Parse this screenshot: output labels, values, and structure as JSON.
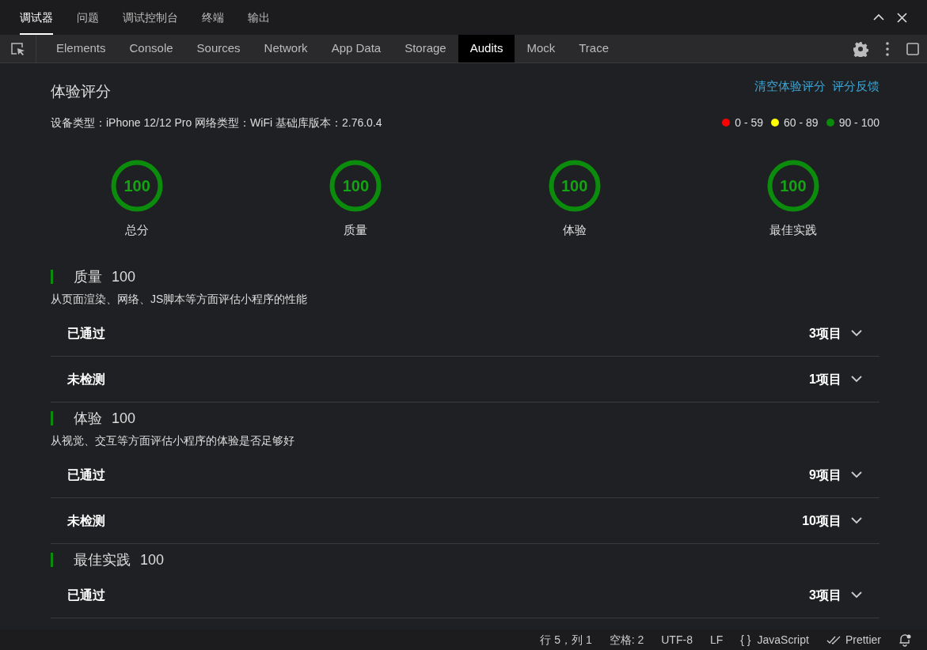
{
  "panel_tabs": [
    {
      "label": "调试器",
      "selected": true
    },
    {
      "label": "问题",
      "selected": false
    },
    {
      "label": "调试控制台",
      "selected": false
    },
    {
      "label": "终端",
      "selected": false
    },
    {
      "label": "输出",
      "selected": false
    }
  ],
  "devtools_tabs": [
    {
      "label": "Elements",
      "selected": false
    },
    {
      "label": "Console",
      "selected": false
    },
    {
      "label": "Sources",
      "selected": false
    },
    {
      "label": "Network",
      "selected": false
    },
    {
      "label": "App Data",
      "selected": false
    },
    {
      "label": "Storage",
      "selected": false
    },
    {
      "label": "Audits",
      "selected": true
    },
    {
      "label": "Mock",
      "selected": false
    },
    {
      "label": "Trace",
      "selected": false
    }
  ],
  "audit": {
    "title": "体验评分",
    "links": [
      "清空体验评分",
      "评分反馈"
    ],
    "device_info": "设备类型：iPhone 12/12 Pro 网络类型：WiFi 基础库版本：2.76.0.4",
    "legend": [
      {
        "label": "0 - 59",
        "color": "#ff0000"
      },
      {
        "label": "60 - 89",
        "color": "#ffff00"
      },
      {
        "label": "90 - 100",
        "color": "#0a8a0a"
      }
    ],
    "scores": [
      {
        "value": "100",
        "label": "总分"
      },
      {
        "value": "100",
        "label": "质量"
      },
      {
        "value": "100",
        "label": "体验"
      },
      {
        "value": "100",
        "label": "最佳实践"
      }
    ],
    "sections": [
      {
        "title": "质量",
        "score": "100",
        "description": "从页面渲染、网络、JS脚本等方面评估小程序的性能",
        "rows": [
          {
            "label": "已通过",
            "count": "3项目",
            "expanded": false
          },
          {
            "label": "未检测",
            "count": "1项目",
            "expanded": false
          }
        ]
      },
      {
        "title": "体验",
        "score": "100",
        "description": "从视觉、交互等方面评估小程序的体验是否足够好",
        "rows": [
          {
            "label": "已通过",
            "count": "9项目",
            "expanded": false
          },
          {
            "label": "未检测",
            "count": "10项目",
            "expanded": false
          }
        ]
      },
      {
        "title": "最佳实践",
        "score": "100",
        "rows": [
          {
            "label": "已通过",
            "count": "3项目",
            "expanded": false
          }
        ]
      }
    ]
  },
  "status_bar": [
    {
      "kind": "text",
      "label": "行 5，列 1"
    },
    {
      "kind": "text",
      "label": "空格: 2"
    },
    {
      "kind": "text",
      "label": "UTF-8"
    },
    {
      "kind": "text",
      "label": "LF"
    },
    {
      "kind": "language",
      "icon": "{ }",
      "label": "JavaScript"
    },
    {
      "kind": "formatter",
      "label": "Prettier"
    }
  ]
}
